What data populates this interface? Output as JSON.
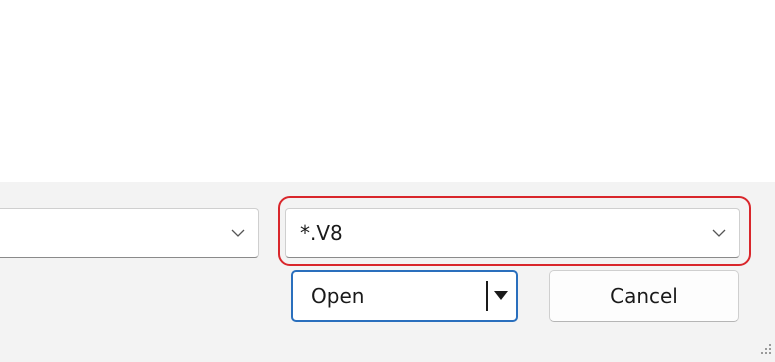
{
  "dialog": {
    "filename_field": {
      "value": ""
    },
    "file_type_filter": {
      "value": "*.V8"
    },
    "open_button_label": "Open",
    "cancel_button_label": "Cancel"
  },
  "colors": {
    "highlight": "#d9262b",
    "primary_border": "#2a6fbd",
    "footer_background": "#f3f3f3"
  },
  "icons": {
    "dropdown": "chevron-down-icon",
    "split": "caret-down-icon",
    "resize": "resize-grip-icon"
  }
}
